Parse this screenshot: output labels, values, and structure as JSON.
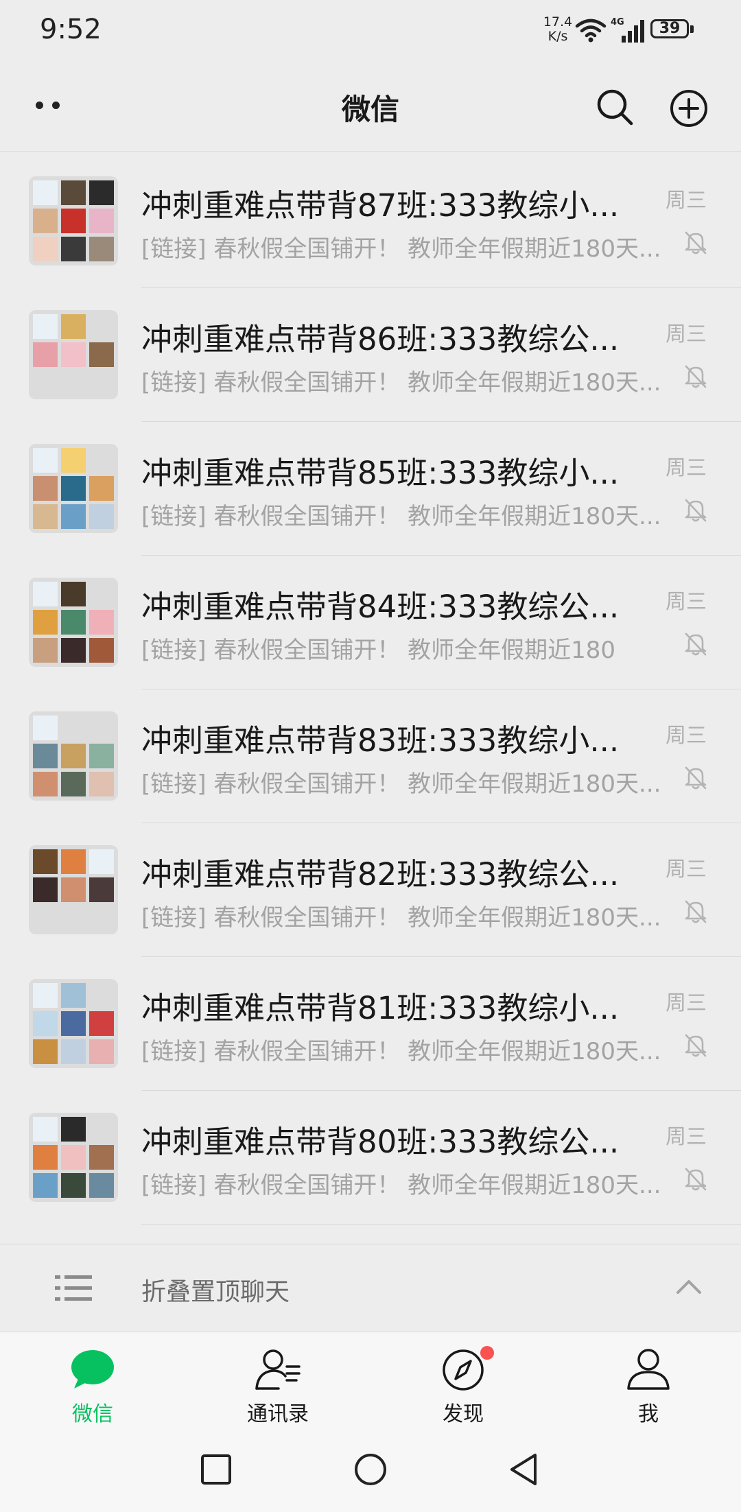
{
  "status_bar": {
    "time": "9:52",
    "net_speed_value": "17.4",
    "net_speed_unit": "K/s",
    "network_type": "4G",
    "battery": "39"
  },
  "header": {
    "title": "微信",
    "more_icon": "more-dots-icon",
    "search_icon": "search-icon",
    "add_icon": "plus-circle-icon"
  },
  "chats": [
    {
      "name": "冲刺重难点带背87班:333教综小...",
      "preview": "[链接] 春秋假全国铺开！ 教师全年假期近180天...",
      "time": "周三",
      "muted": true
    },
    {
      "name": "冲刺重难点带背86班:333教综公...",
      "preview": "[链接] 春秋假全国铺开！ 教师全年假期近180天...",
      "time": "周三",
      "muted": true
    },
    {
      "name": "冲刺重难点带背85班:333教综小...",
      "preview": "[链接] 春秋假全国铺开！ 教师全年假期近180天...",
      "time": "周三",
      "muted": true
    },
    {
      "name": "冲刺重难点带背84班:333教综公...",
      "preview": "[链接] 春秋假全国铺开！ 教师全年假期近180",
      "time": "周三",
      "muted": true
    },
    {
      "name": "冲刺重难点带背83班:333教综小...",
      "preview": "[链接] 春秋假全国铺开！ 教师全年假期近180天...",
      "time": "周三",
      "muted": true
    },
    {
      "name": "冲刺重难点带背82班:333教综公...",
      "preview": "[链接] 春秋假全国铺开！ 教师全年假期近180天...",
      "time": "周三",
      "muted": true
    },
    {
      "name": "冲刺重难点带背81班:333教综小...",
      "preview": "[链接] 春秋假全国铺开！ 教师全年假期近180天...",
      "time": "周三",
      "muted": true
    },
    {
      "name": "冲刺重难点带背80班:333教综公...",
      "preview": "[链接] 春秋假全国铺开！ 教师全年假期近180天...",
      "time": "周三",
      "muted": true
    }
  ],
  "folded_pinned": {
    "label": "折叠置顶聊天",
    "icon": "list-icon",
    "chevron": "chevron-up-icon"
  },
  "tabs": [
    {
      "label": "微信",
      "icon": "chat-bubble-icon",
      "active": true
    },
    {
      "label": "通讯录",
      "icon": "contacts-icon",
      "active": false
    },
    {
      "label": "发现",
      "icon": "compass-icon",
      "active": false,
      "badge": true
    },
    {
      "label": "我",
      "icon": "person-icon",
      "active": false
    }
  ],
  "colors": {
    "accent": "#07c160",
    "badge": "#fa5151",
    "background": "#ededed"
  }
}
